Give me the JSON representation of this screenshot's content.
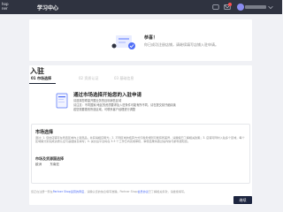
{
  "app": {
    "brand": "hop\nner",
    "title": "学习中心"
  },
  "top_icons": {
    "messages": "message-icon",
    "mail": "mail-icon",
    "help": "help-icon",
    "avatar": "avatar"
  },
  "welcome": {
    "title": "恭喜！",
    "subtitle": "你已成功注册店铺，请继续填写店铺入驻申请。"
  },
  "onboarding": {
    "title": "入驻",
    "steps": [
      {
        "label": "01 市场选择"
      },
      {
        "label": "02 资质认证"
      },
      {
        "label": "03 基础信息"
      }
    ],
    "banner": {
      "title": "通过市场选择开始您的入驻申请",
      "lines": [
        "请选择您希望开展业务的目标销售区域",
        "请注意：不同国家/地区的资质要求及入驻条件可能有所不同，请在提交前仔细阅读",
        "若您需要更改所选区域，可联系客户经理进行调整"
      ]
    },
    "market_box": {
      "title": "市场选择",
      "description": "通过: 1. 您的店铺可在所选区域内上架商品，并获得相应曝光；2. 不同区域的结算方式与税务规则可能有所差异，请确保已了解相关政策；3. 店铺可同时入驻多个区域，每个区域需分别完成资质认证与基础信息填写；4. 提交后平台将在 3-5 个工作日内完成审核，审核结果将通过站内信与邮件通知您。",
      "region_label": "市场及货源国选择",
      "options": [
        "欧洲",
        "东南亚"
      ]
    },
    "footer": {
      "prefix": "您正在注册一家在",
      "link1": "Partner Shop运营的商店",
      "middle": "，请确认您的信息填写准确。Partner Shop",
      "link2": "会员协议",
      "suffix": "已了解相关条款，请继续填写。"
    },
    "next_button": "继续"
  },
  "colors": {
    "topbar": "#2f3340",
    "accent": "#4f6ef7",
    "button": "#1d2540"
  }
}
